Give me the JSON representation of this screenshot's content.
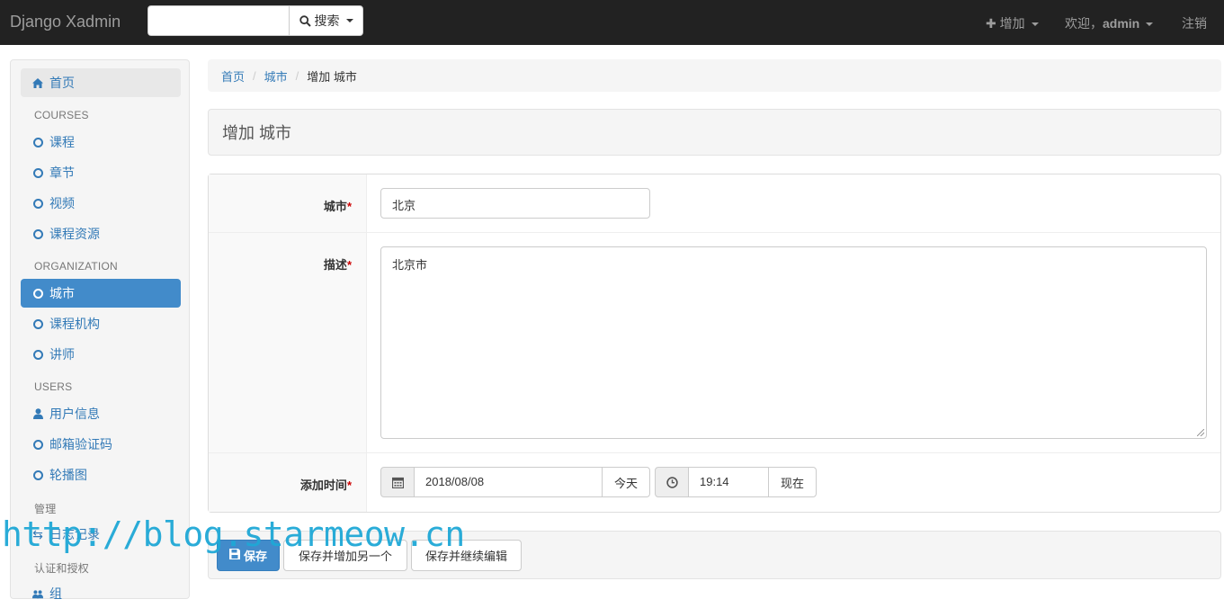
{
  "navbar": {
    "brand": "Django Xadmin",
    "search_placeholder": "",
    "search_label": "搜索",
    "add_label": "增加",
    "welcome_label": "欢迎，",
    "username": "admin",
    "logout_label": "注销"
  },
  "sidebar": {
    "home": "首页",
    "sections": [
      {
        "header": "COURSES",
        "items": [
          "课程",
          "章节",
          "视频",
          "课程资源"
        ]
      },
      {
        "header": "ORGANIZATION",
        "items": [
          "城市",
          "课程机构",
          "讲师"
        ]
      },
      {
        "header": "USERS",
        "items": [
          "用户信息",
          "邮箱验证码",
          "轮播图"
        ]
      },
      {
        "header": "管理",
        "items": [
          "日志记录"
        ]
      },
      {
        "header": "认证和授权",
        "items": [
          "组"
        ]
      }
    ],
    "active_item": "城市"
  },
  "breadcrumb": {
    "home": "首页",
    "model": "城市",
    "current": "增加 城市"
  },
  "page": {
    "title": "增加 城市"
  },
  "form": {
    "city_label": "城市",
    "city_value": "北京",
    "desc_label": "描述",
    "desc_value": "北京市",
    "time_label": "添加时间",
    "date_value": "2018/08/08",
    "today_label": "今天",
    "time_value": "19:14",
    "now_label": "现在",
    "required_mark": "*"
  },
  "actions": {
    "save": "保存",
    "save_add": "保存并增加另一个",
    "save_continue": "保存并继续编辑"
  },
  "watermark": "http://blog.starmeow.cn",
  "colors": {
    "navbar_bg": "#222222",
    "primary": "#428bca",
    "link": "#337ab7",
    "watermark": "#1fa8d6"
  }
}
